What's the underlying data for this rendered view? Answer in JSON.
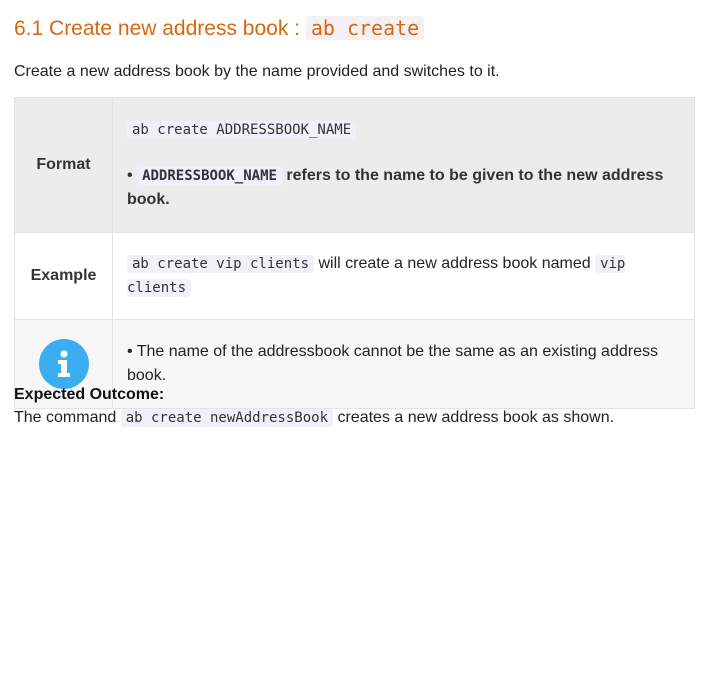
{
  "section": {
    "title_prefix": "6.1 Create new address book : ",
    "title_code": "ab create"
  },
  "intro": "Create a new address book by the name provided and switches to it.",
  "table": {
    "format": {
      "header": "Format",
      "code": "ab create ADDRESSBOOK_NAME",
      "bullet": "•",
      "param_code": "ADDRESSBOOK_NAME",
      "param_desc": "refers to the name to be given to the new address book."
    },
    "example": {
      "header": "Example",
      "code1": "ab create vip clients",
      "text": "will create a new address book named",
      "code2": "vip clients"
    },
    "note": {
      "icon": "info-icon",
      "icon_color": "#3aaef0",
      "text": "• The name of the addressbook cannot be the same as an existing address book."
    }
  },
  "outcome": {
    "label": "Expected Outcome:",
    "text_before": "The command",
    "code": "ab create newAddressBook",
    "text_after": "creates a new address book as shown."
  }
}
